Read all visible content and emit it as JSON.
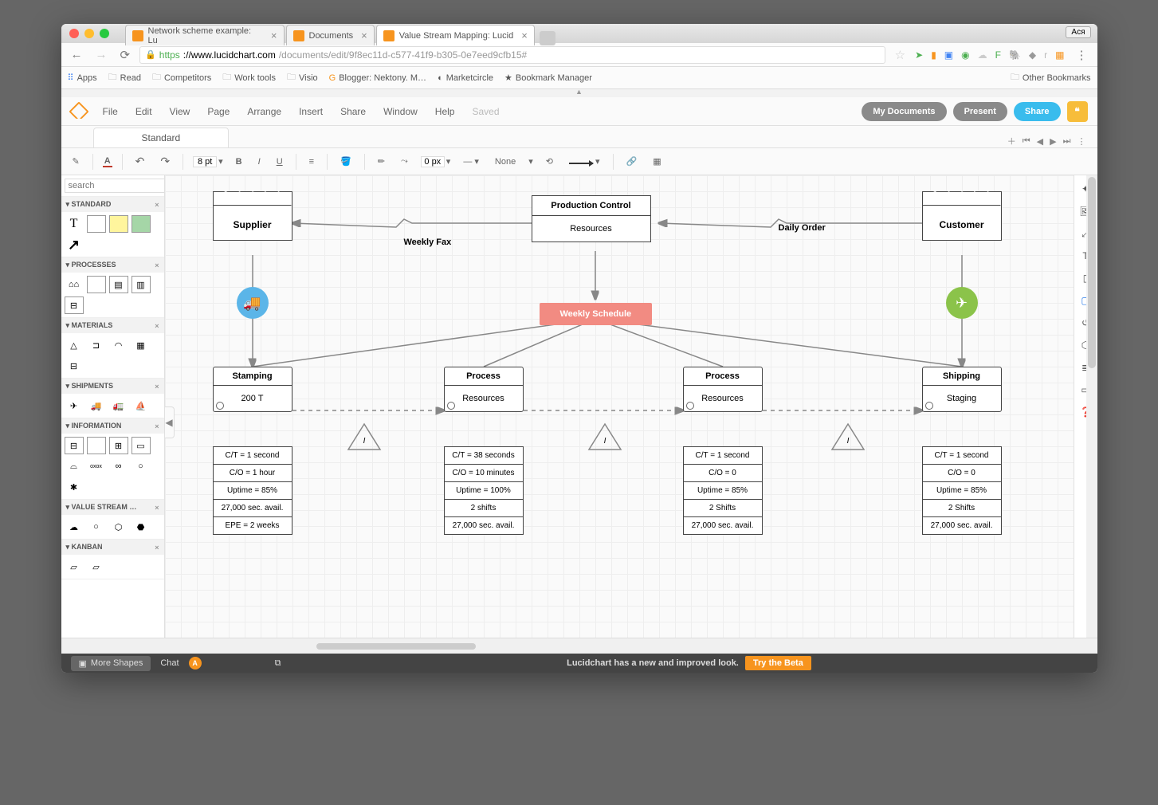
{
  "titlebar": {
    "user": "Ася"
  },
  "browser": {
    "tabs": [
      {
        "favicon": true,
        "title": "Network scheme example: Lu",
        "active": false
      },
      {
        "favicon": true,
        "title": "Documents",
        "active": false
      },
      {
        "favicon": true,
        "title": "Value Stream Mapping: Lucid",
        "active": true
      }
    ],
    "url_protocol": "https",
    "url_host": "://www.lucidchart.com",
    "url_path": "/documents/edit/9f8ec11d-c577-41f9-b305-0e7eed9cfb15#",
    "bookmarks": [
      "Apps",
      "Read",
      "Competitors",
      "Work tools",
      "Visio",
      "Blogger: Nektony. M…",
      "Marketcircle",
      "Bookmark Manager"
    ],
    "other_bookmarks": "Other Bookmarks"
  },
  "app": {
    "menus": [
      "File",
      "Edit",
      "View",
      "Page",
      "Arrange",
      "Insert",
      "Share",
      "Window",
      "Help"
    ],
    "saved": "Saved",
    "buttons": {
      "docs": "My Documents",
      "present": "Present",
      "share": "Share"
    },
    "doc_tab": "Standard",
    "toolbar": {
      "fontsize": "8 pt",
      "linewidth": "0 px",
      "linestyle": "None"
    }
  },
  "shapes_panel": {
    "search_placeholder": "search",
    "sections": [
      "STANDARD",
      "PROCESSES",
      "MATERIALS",
      "SHIPMENTS",
      "INFORMATION",
      "VALUE STREAM …",
      "KANBAN"
    ]
  },
  "canvas": {
    "supplier": {
      "label": "Supplier"
    },
    "customer": {
      "label": "Customer"
    },
    "control": {
      "title": "Production Control",
      "body": "Resources"
    },
    "schedule": "Weekly Schedule",
    "arrow_labels": {
      "weekly_fax": "Weekly Fax",
      "daily_order": "Daily Order"
    },
    "processes": [
      {
        "title": "Stamping",
        "body": "200 T"
      },
      {
        "title": "Process",
        "body": "Resources"
      },
      {
        "title": "Process",
        "body": "Resources"
      },
      {
        "title": "Shipping",
        "body": "Staging"
      }
    ],
    "databoxes": [
      [
        "C/T = 1 second",
        "C/O = 1 hour",
        "Uptime = 85%",
        "27,000 sec. avail.",
        "EPE = 2 weeks"
      ],
      [
        "C/T = 38 seconds",
        "C/O = 10 minutes",
        "Uptime = 100%",
        "2 shifts",
        "27,000 sec. avail."
      ],
      [
        "C/T = 1 second",
        "C/O = 0",
        "Uptime = 85%",
        "2 Shifts",
        "27,000 sec. avail."
      ],
      [
        "C/T = 1 second",
        "C/O = 0",
        "Uptime = 85%",
        "2 Shifts",
        "27,000 sec. avail."
      ]
    ],
    "triangle_label": "I"
  },
  "footer": {
    "more_shapes": "More Shapes",
    "chat": "Chat",
    "beta_msg": "Lucidchart has a new and improved look.",
    "beta_btn": "Try the Beta"
  }
}
